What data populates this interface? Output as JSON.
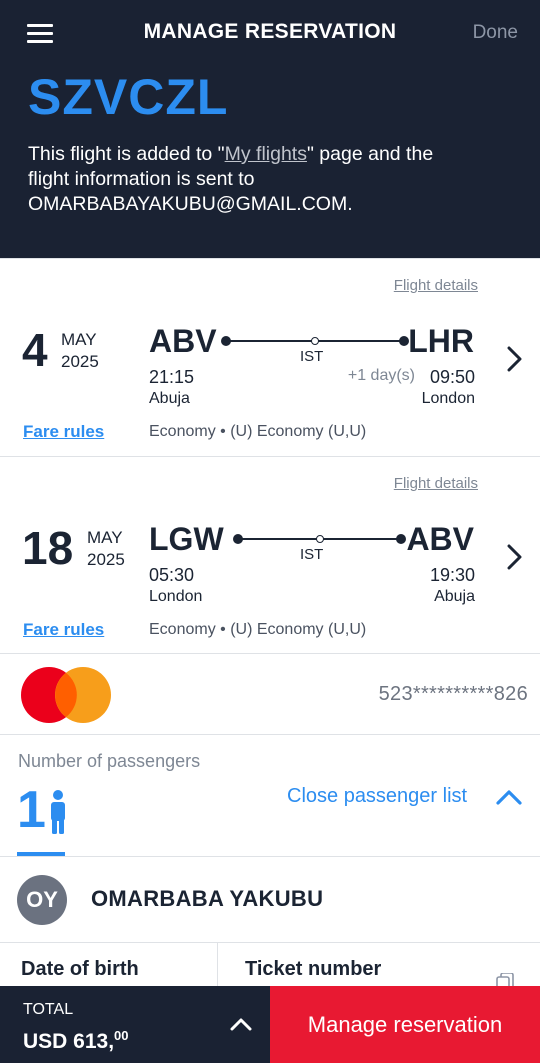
{
  "header": {
    "title": "MANAGE RESERVATION",
    "done_label": "Done",
    "pnr": "SZVCZL",
    "info_prefix": "This flight is added to \"",
    "info_link": "My flights",
    "info_suffix": "\" page and the flight information is sent to OMARBABAYAKUBU@GMAIL.COM."
  },
  "flights": [
    {
      "details_label": "Flight details",
      "day": "4",
      "month": "MAY",
      "year": "2025",
      "origin": "ABV",
      "destination": "LHR",
      "stop": "IST",
      "dep_time": "21:15",
      "arr_time": "09:50",
      "plus_day": "+1 day(s)",
      "dep_city": "Abuja",
      "arr_city": "London",
      "fare_label": "Fare rules",
      "cabin": "Economy  •  (U) Economy (U,U)"
    },
    {
      "details_label": "Flight details",
      "day": "18",
      "month": "MAY",
      "year": "2025",
      "origin": "LGW",
      "destination": "ABV",
      "stop": "IST",
      "dep_time": "05:30",
      "arr_time": "19:30",
      "dep_city": "London",
      "arr_city": "Abuja",
      "fare_label": "Fare rules",
      "cabin": "Economy  •  (U) Economy (U,U)"
    }
  ],
  "payment": {
    "card_icon": "mastercard-logo",
    "card_number": "523**********826",
    "colors": {
      "red": "#eb001b",
      "orange": "#f79e1b"
    }
  },
  "passengers": {
    "label": "Number of passengers",
    "count": "1",
    "close_label": "Close passenger list",
    "list": [
      {
        "initials": "OY",
        "name": "OMARBABA YAKUBU"
      }
    ],
    "dob_label": "Date of birth",
    "ticket_label": "Ticket number"
  },
  "footer": {
    "total_label": "TOTAL",
    "total_amount": "USD 613,",
    "total_cents": "00",
    "manage_label": "Manage reservation"
  },
  "colors": {
    "header_bg": "#1a2233",
    "accent_blue": "#2c8df0",
    "cta_red": "#e81932"
  }
}
